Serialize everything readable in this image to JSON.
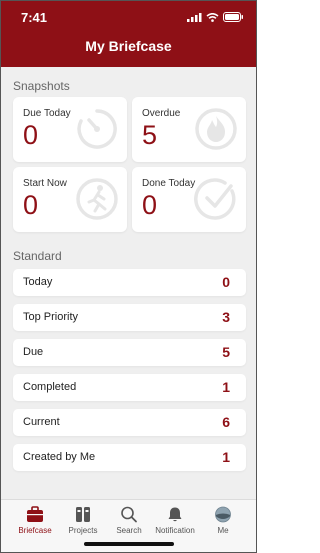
{
  "status": {
    "time": "7:41"
  },
  "header": {
    "title": "My Briefcase"
  },
  "snapshots": {
    "label": "Snapshots",
    "cards": [
      {
        "label": "Due Today",
        "value": "0",
        "icon": "stopwatch-icon"
      },
      {
        "label": "Overdue",
        "value": "5",
        "icon": "flame-icon"
      },
      {
        "label": "Start Now",
        "value": "0",
        "icon": "running-person-icon"
      },
      {
        "label": "Done Today",
        "value": "0",
        "icon": "check-circle-icon"
      }
    ]
  },
  "standard": {
    "label": "Standard",
    "rows": [
      {
        "label": "Today",
        "count": "0"
      },
      {
        "label": "Top Priority",
        "count": "3"
      },
      {
        "label": "Due",
        "count": "5"
      },
      {
        "label": "Completed",
        "count": "1"
      },
      {
        "label": "Current",
        "count": "6"
      },
      {
        "label": "Created by Me",
        "count": "1"
      }
    ]
  },
  "nav": {
    "items": [
      {
        "label": "Briefcase",
        "icon": "briefcase-icon",
        "active": true
      },
      {
        "label": "Projects",
        "icon": "projects-icon",
        "active": false
      },
      {
        "label": "Search",
        "icon": "search-icon",
        "active": false
      },
      {
        "label": "Notification",
        "icon": "bell-icon",
        "active": false
      },
      {
        "label": "Me",
        "icon": "avatar-icon",
        "active": false
      }
    ]
  },
  "colors": {
    "brand": "#8e1016",
    "background": "#efefef"
  }
}
